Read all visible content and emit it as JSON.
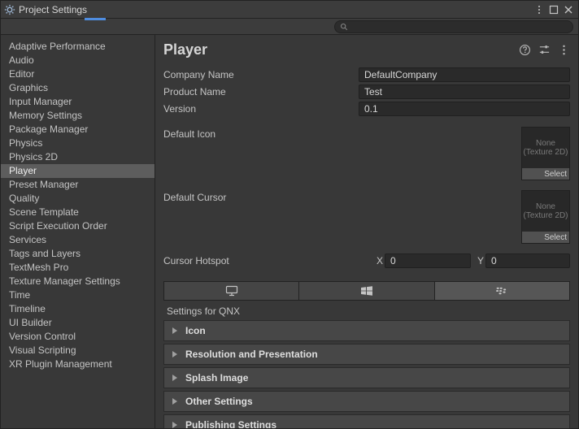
{
  "window": {
    "title": "Project Settings"
  },
  "sidebar": {
    "items": [
      {
        "label": "Adaptive Performance",
        "selected": false
      },
      {
        "label": "Audio",
        "selected": false
      },
      {
        "label": "Editor",
        "selected": false
      },
      {
        "label": "Graphics",
        "selected": false
      },
      {
        "label": "Input Manager",
        "selected": false
      },
      {
        "label": "Memory Settings",
        "selected": false
      },
      {
        "label": "Package Manager",
        "selected": false
      },
      {
        "label": "Physics",
        "selected": false
      },
      {
        "label": "Physics 2D",
        "selected": false
      },
      {
        "label": "Player",
        "selected": true
      },
      {
        "label": "Preset Manager",
        "selected": false
      },
      {
        "label": "Quality",
        "selected": false
      },
      {
        "label": "Scene Template",
        "selected": false
      },
      {
        "label": "Script Execution Order",
        "selected": false
      },
      {
        "label": "Services",
        "selected": false
      },
      {
        "label": "Tags and Layers",
        "selected": false
      },
      {
        "label": "TextMesh Pro",
        "selected": false
      },
      {
        "label": "Texture Manager Settings",
        "selected": false
      },
      {
        "label": "Time",
        "selected": false
      },
      {
        "label": "Timeline",
        "selected": false
      },
      {
        "label": "UI Builder",
        "selected": false
      },
      {
        "label": "Version Control",
        "selected": false
      },
      {
        "label": "Visual Scripting",
        "selected": false
      },
      {
        "label": "XR Plugin Management",
        "selected": false
      }
    ]
  },
  "content": {
    "title": "Player",
    "company_name": {
      "label": "Company Name",
      "value": "DefaultCompany"
    },
    "product_name": {
      "label": "Product Name",
      "value": "Test"
    },
    "version": {
      "label": "Version",
      "value": "0.1"
    },
    "default_icon": {
      "label": "Default Icon",
      "none": "None",
      "type": "(Texture 2D)",
      "select": "Select"
    },
    "default_cursor": {
      "label": "Default Cursor",
      "none": "None",
      "type": "(Texture 2D)",
      "select": "Select"
    },
    "cursor_hotspot": {
      "label": "Cursor Hotspot",
      "x_label": "X",
      "x_value": "0",
      "y_label": "Y",
      "y_value": "0"
    },
    "platform_tabs": [
      {
        "name": "standalone",
        "icon": "monitor",
        "active": false
      },
      {
        "name": "windows",
        "icon": "windows",
        "active": false
      },
      {
        "name": "qnx",
        "icon": "blackberry",
        "active": true
      }
    ],
    "settings_for": "Settings for QNX",
    "foldouts": [
      {
        "label": "Icon"
      },
      {
        "label": "Resolution and Presentation"
      },
      {
        "label": "Splash Image"
      },
      {
        "label": "Other Settings"
      },
      {
        "label": "Publishing Settings"
      }
    ]
  }
}
